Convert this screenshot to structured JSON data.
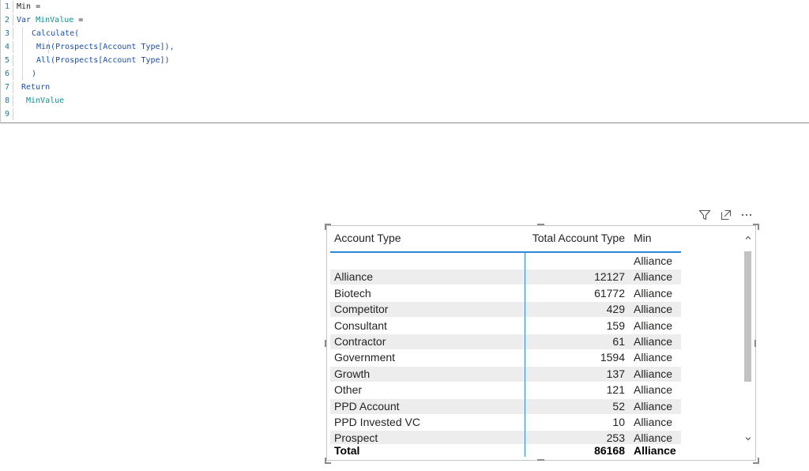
{
  "editor": {
    "lines": [
      {
        "num": "1",
        "parts": [
          {
            "t": "Min =",
            "c": "txt"
          }
        ]
      },
      {
        "num": "2",
        "parts": [
          {
            "t": "Var ",
            "c": "kw"
          },
          {
            "t": "MinValue",
            "c": "var"
          },
          {
            "t": " =",
            "c": "txt"
          }
        ]
      },
      {
        "num": "3",
        "parts": [
          {
            "t": "Calculate(",
            "c": "fn"
          }
        ]
      },
      {
        "num": "4",
        "parts": [
          {
            "t": "Min(Prospects[Account Type]),",
            "c": "fn"
          }
        ]
      },
      {
        "num": "5",
        "parts": [
          {
            "t": "All(Prospects[Account Type])",
            "c": "fn"
          }
        ]
      },
      {
        "num": "6",
        "parts": [
          {
            "t": ")",
            "c": "fn"
          }
        ]
      },
      {
        "num": "7",
        "parts": [
          {
            "t": "Return",
            "c": "kw"
          }
        ]
      },
      {
        "num": "8",
        "parts": [
          {
            "t": "MinValue",
            "c": "var"
          }
        ]
      },
      {
        "num": "9",
        "parts": []
      }
    ]
  },
  "visual_header": {
    "icons": [
      "filter-icon",
      "focus-mode-icon",
      "more-options-icon"
    ]
  },
  "table": {
    "columns": [
      "Account Type",
      "Total Account Type",
      "Min"
    ],
    "rows": [
      {
        "type": "",
        "total": "",
        "min": "Alliance"
      },
      {
        "type": "Alliance",
        "total": "12127",
        "min": "Alliance"
      },
      {
        "type": "Biotech",
        "total": "61772",
        "min": "Alliance"
      },
      {
        "type": "Competitor",
        "total": "429",
        "min": "Alliance"
      },
      {
        "type": "Consultant",
        "total": "159",
        "min": "Alliance"
      },
      {
        "type": "Contractor",
        "total": "61",
        "min": "Alliance"
      },
      {
        "type": "Government",
        "total": "1594",
        "min": "Alliance"
      },
      {
        "type": "Growth",
        "total": "137",
        "min": "Alliance"
      },
      {
        "type": "Other",
        "total": "121",
        "min": "Alliance"
      },
      {
        "type": "PPD Account",
        "total": "52",
        "min": "Alliance"
      },
      {
        "type": "PPD Invested VC",
        "total": "10",
        "min": "Alliance"
      },
      {
        "type": "Prospect",
        "total": "253",
        "min": "Alliance"
      }
    ],
    "total": {
      "type": "Total",
      "total": "86168",
      "min": "Alliance"
    }
  },
  "colors": {
    "accent": "#2b88d8",
    "row_band": "#ededed",
    "keyword": "#1a4fa8",
    "variable": "#0f8f8f"
  }
}
